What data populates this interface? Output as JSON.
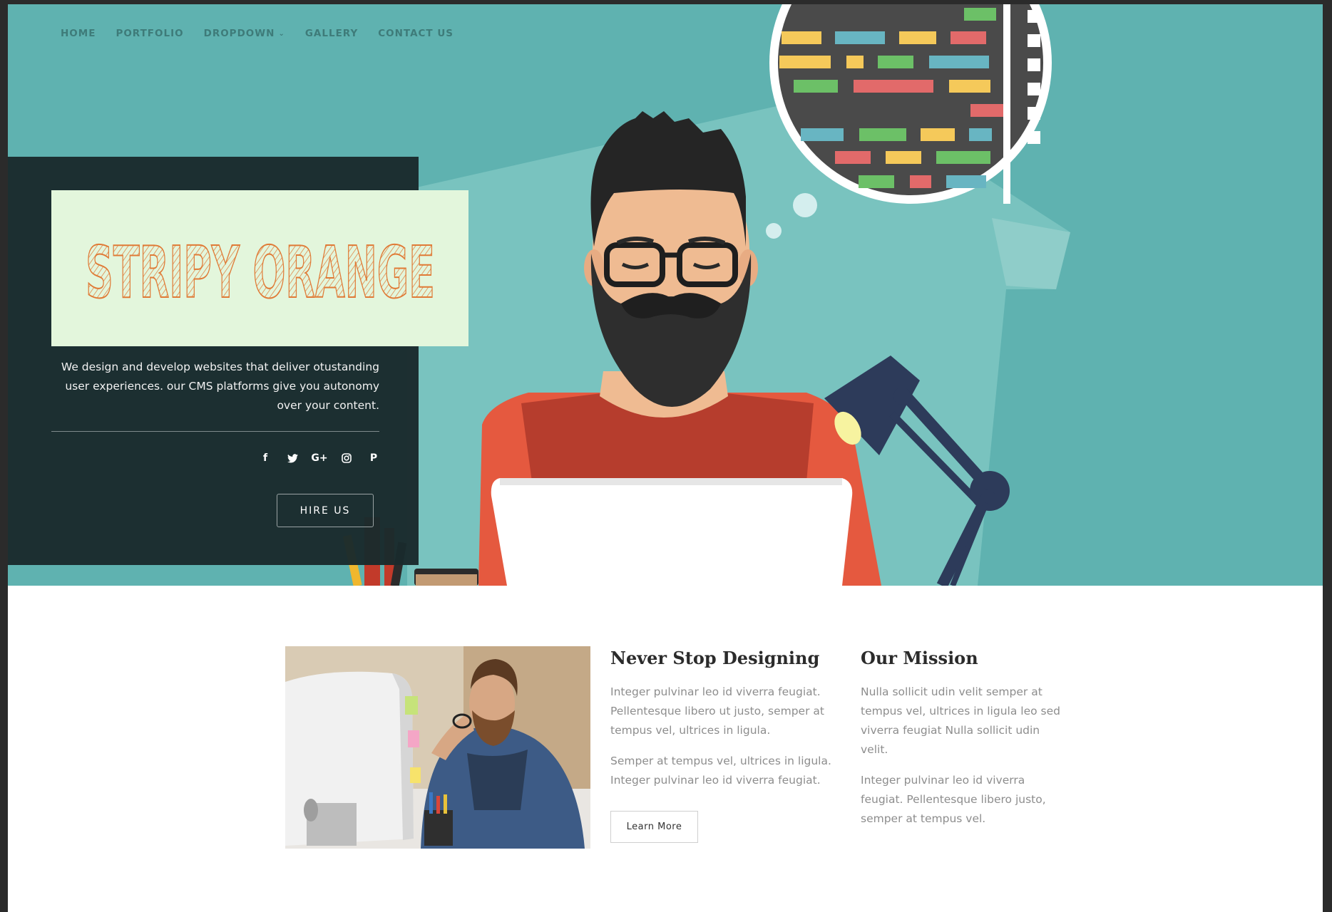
{
  "nav": {
    "items": [
      {
        "label": "HOME"
      },
      {
        "label": "PORTFOLIO"
      },
      {
        "label": "DROPDOWN",
        "has_dropdown": true
      },
      {
        "label": "GALLERY"
      },
      {
        "label": "CONTACT US"
      }
    ]
  },
  "hero": {
    "logo_text": "STRIPY ORANGE",
    "tagline": "We design and develop websites that deliver otustanding user experiences. our CMS platforms give you autonomy over your content.",
    "socials": [
      {
        "icon": "facebook-icon",
        "glyph": "f"
      },
      {
        "icon": "twitter-icon",
        "glyph": "🐦"
      },
      {
        "icon": "google-plus-icon",
        "glyph": "G+"
      },
      {
        "icon": "instagram-icon",
        "glyph": "◎"
      },
      {
        "icon": "pinterest-icon",
        "glyph": "P"
      }
    ],
    "hire_label": "HIRE US"
  },
  "features": {
    "col1": {
      "title": "Never Stop Designing",
      "p1": "Integer pulvinar leo id viverra feugiat. Pellentesque libero ut justo, semper at tempus vel, ultrices in ligula.",
      "p2": "Semper at tempus vel, ultrices in ligula. Integer pulvinar leo id viverra feugiat.",
      "button": "Learn More"
    },
    "col2": {
      "title": "Our Mission",
      "p1": "Nulla sollicit udin velit semper at tempus vel, ultrices in ligula leo sed viverra feugiat Nulla sollicit udin velit.",
      "p2": "Integer pulvinar leo id viverra feugiat. Pellentesque libero justo, semper at tempus vel."
    }
  },
  "colors": {
    "hero_bg": "#5fb2b0",
    "panel_bg": "#1a2a2c",
    "logo_bg": "#e3f6dc",
    "logo_text": "#e07a36",
    "nav_text": "#3e7b79"
  }
}
